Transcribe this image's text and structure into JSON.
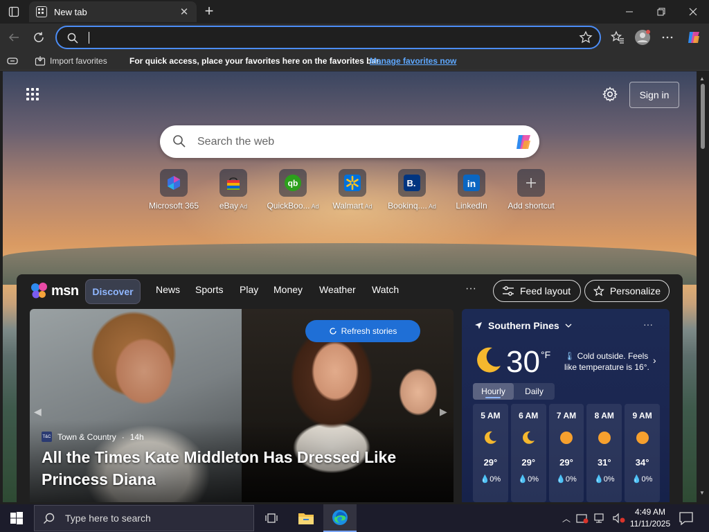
{
  "browser": {
    "tab_title": "New tab",
    "address": {
      "value": ""
    },
    "favbar": {
      "import_label": "Import favorites",
      "message": "For quick access, place your favorites here on the favorites bar.",
      "manage_link": "Manage favorites now"
    }
  },
  "newtab": {
    "signin_label": "Sign in",
    "search_placeholder": "Search the web",
    "shortcuts": [
      {
        "label": "Microsoft 365",
        "ad": "",
        "icon": "microsoft-365-icon"
      },
      {
        "label": "eBay",
        "ad": "Ad",
        "icon": "ebay-icon"
      },
      {
        "label": "QuickBoo...",
        "ad": "Ad",
        "icon": "quickbooks-icon"
      },
      {
        "label": "Walmart",
        "ad": "Ad",
        "icon": "walmart-icon"
      },
      {
        "label": "Bookinq....",
        "ad": "Ad",
        "icon": "booking-icon"
      },
      {
        "label": "LinkedIn",
        "ad": "",
        "icon": "linkedin-icon"
      },
      {
        "label": "Add shortcut",
        "ad": "",
        "icon": "plus-icon"
      }
    ]
  },
  "msn": {
    "logo_text": "msn",
    "tabs": [
      "Discover",
      "News",
      "Sports",
      "Play",
      "Money",
      "Weather",
      "Watch"
    ],
    "more": "···",
    "feed_layout_label": "Feed layout",
    "personalize_label": "Personalize",
    "refresh_label": "Refresh stories",
    "story": {
      "source_logo": "T&C",
      "source": "Town & Country",
      "age": "14h",
      "headline": "All the Times Kate Middleton Has Dressed Like Princess Diana"
    }
  },
  "weather": {
    "location": "Southern Pines",
    "temp": "30",
    "unit": "°F",
    "summary": "Cold outside. Feels like temperature is 16°.",
    "tabs": [
      "Hourly",
      "Daily"
    ],
    "hourly": [
      {
        "time": "5 AM",
        "icon": "moon-icon",
        "temp": "29°",
        "precip": "0%"
      },
      {
        "time": "6 AM",
        "icon": "moon-icon",
        "temp": "29°",
        "precip": "0%"
      },
      {
        "time": "7 AM",
        "icon": "sun-icon",
        "temp": "29°",
        "precip": "0%"
      },
      {
        "time": "8 AM",
        "icon": "sun-icon",
        "temp": "31°",
        "precip": "0%"
      },
      {
        "time": "9 AM",
        "icon": "sun-icon",
        "temp": "34°",
        "precip": "0%"
      }
    ]
  },
  "taskbar": {
    "search_placeholder": "Type here to search",
    "time": "4:49 AM",
    "date": "11/11/2025"
  },
  "colors": {
    "accent": "#4c8df6",
    "refresh_button": "#1f6fd6",
    "weather_panel": "#1c2a54"
  }
}
